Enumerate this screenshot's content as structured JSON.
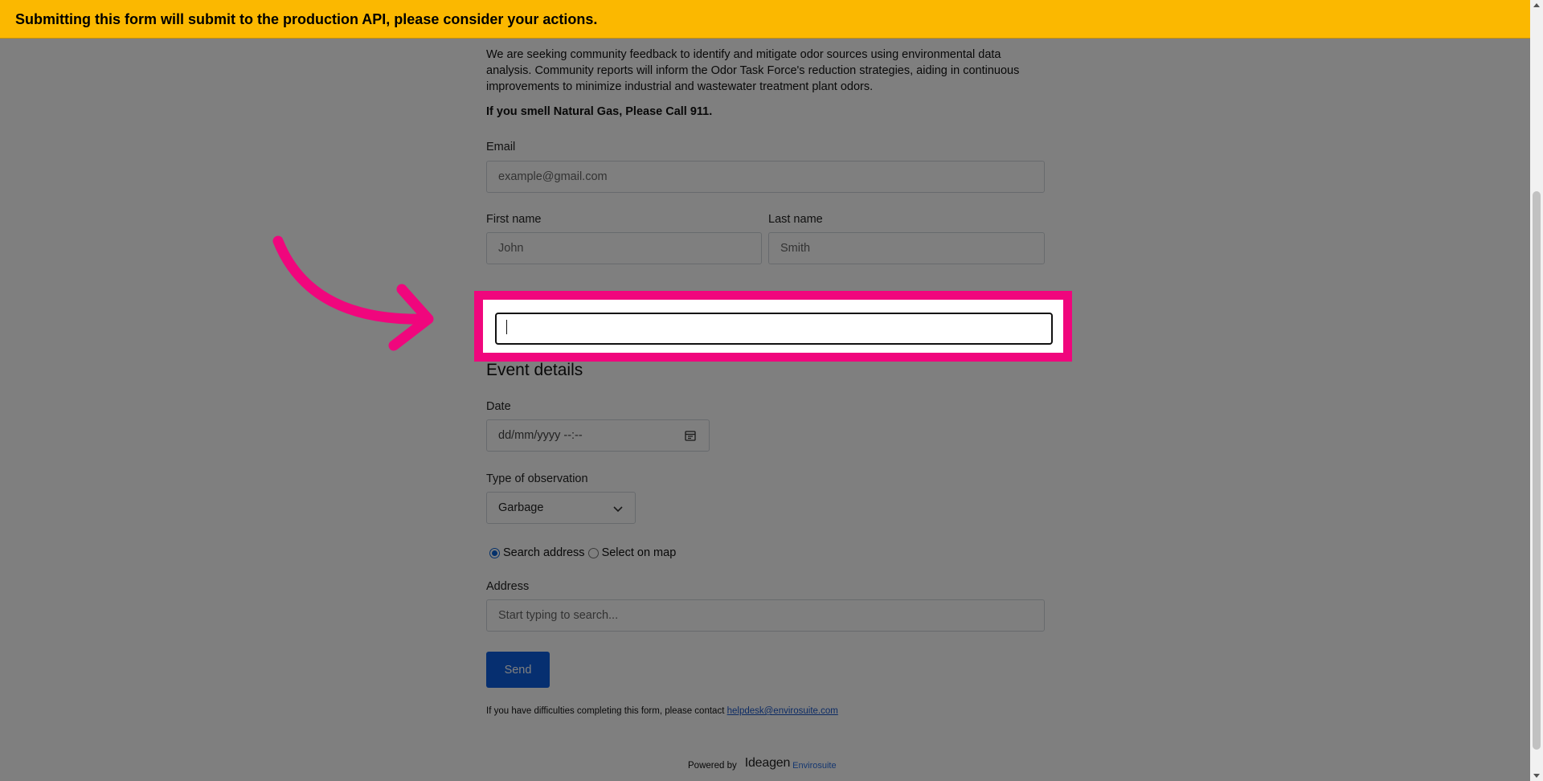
{
  "banner": {
    "text": "Submitting this form will submit to the production API, please consider your actions.",
    "color": "#fbb800"
  },
  "form": {
    "intro": "We are seeking community feedback to identify and mitigate odor sources using environmental data analysis. Community reports will inform the Odor Task Force's reduction strategies, aiding in continuous improvements to minimize industrial and wastewater treatment plant odors.",
    "gas_warning": "If you smell Natural Gas, Please Call 911.",
    "email_label": "Email",
    "email_placeholder": "example@gmail.com",
    "first_name_label": "First name",
    "first_name_placeholder": "John",
    "last_name_label": "Last name",
    "last_name_placeholder": "Smith",
    "phone_value": "",
    "event_title": "Event details",
    "date_label": "Date",
    "date_placeholder": "dd/mm/yyyy --:--",
    "observation_label": "Type of observation",
    "observation_selected": "Garbage",
    "radio_search": "Search address",
    "radio_map": "Select on map",
    "address_label": "Address",
    "address_placeholder": "Start typing to search...",
    "send_label": "Send",
    "help_text": "If you have difficulties completing this form, please contact ",
    "help_email": "helpdesk@envirosuite.com",
    "powered_by": "Powered by",
    "logo_main": "Ideagen",
    "logo_sub": "Envirosuite"
  },
  "highlight_color": "#f0067d",
  "accent_color": "#0d5fe0"
}
